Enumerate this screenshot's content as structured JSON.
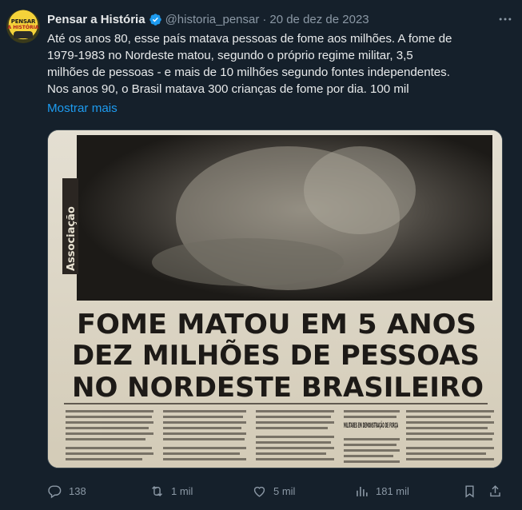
{
  "tweet": {
    "author_name": "Pensar a História",
    "handle": "@historia_pensar",
    "separator": "·",
    "date": "20 de dez de 2023",
    "verified": true,
    "avatar": {
      "line1": "PENSAR",
      "line2": "A HISTÓRIA"
    },
    "text_lines": [
      "Até os anos 80, esse país matava pessoas de fome aos milhões. A fome de",
      "1979-1983 no Nordeste matou, segundo o próprio regime militar, 3,5",
      "milhões de pessoas - e mais de 10 milhões segundo fontes independentes.",
      "Nos anos 90, o Brasil matava 300 crianças de fome por dia. 100 mil"
    ],
    "show_more_label": "Mostrar mais"
  },
  "media": {
    "section_label": "Associação",
    "headline_lines": [
      "FOME MATOU EM 5 ANOS",
      "DEZ MILHÕES DE PESSOAS",
      "NO NORDESTE BRASILEIRO"
    ],
    "subhead": "MILITARES EM DEMONSTRAÇÃO DE FORÇA"
  },
  "actions": {
    "replies": "138",
    "reposts": "1 mil",
    "likes": "5 mil",
    "views": "181 mil"
  },
  "colors": {
    "background": "#15202b",
    "accent": "#1d9bf0",
    "muted": "#8b98a5",
    "text": "#e7e9ea"
  },
  "icons": [
    "verified-badge-icon",
    "more-options-icon",
    "reply-icon",
    "repost-icon",
    "like-icon",
    "views-icon",
    "bookmark-icon",
    "share-icon"
  ]
}
